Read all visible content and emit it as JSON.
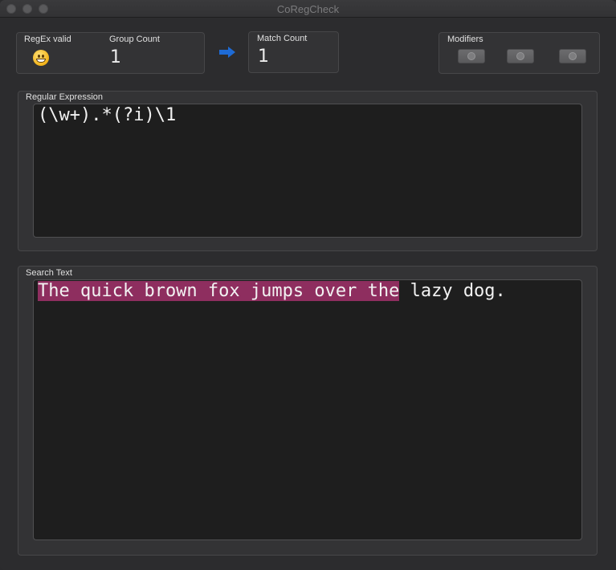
{
  "window": {
    "title": "CoRegCheck"
  },
  "status": {
    "regex_valid_label": "RegEx valid",
    "regex_valid_icon": "smiley-icon",
    "group_count_label": "Group Count",
    "group_count_value": "1",
    "match_count_label": "Match Count",
    "match_count_value": "1",
    "arrow_icon": "right-arrow-icon",
    "arrow_color": "#1e6bd6"
  },
  "modifiers": {
    "label": "Modifiers"
  },
  "regex_panel": {
    "label": "Regular Expression",
    "value": "(\\w+).*(?i)\\1"
  },
  "search_panel": {
    "label": "Search Text",
    "matched_text": "The quick brown fox jumps over the",
    "unmatched_text": " lazy dog.",
    "highlight_color": "#8e2e5f"
  }
}
